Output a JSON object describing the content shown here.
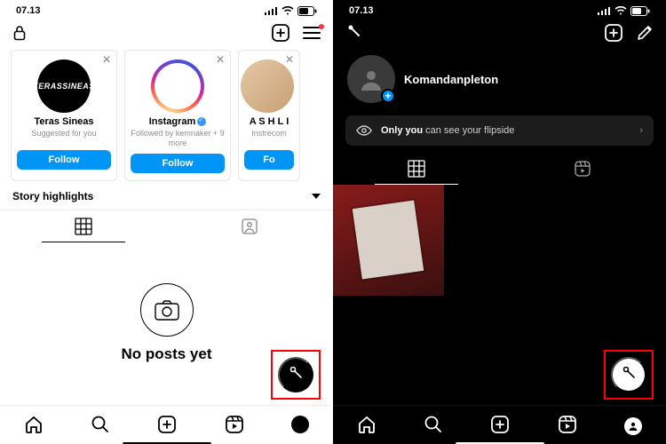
{
  "statusTime": "07.13",
  "light": {
    "suggestions": [
      {
        "name": "Teras Sineas",
        "sub": "Suggested for you",
        "follow": "Follow"
      },
      {
        "name": "Instagram",
        "sub": "Followed by kemnaker + 9 more",
        "follow": "Follow"
      },
      {
        "name": "A S H L I",
        "sub": "Instrecom",
        "follow": "Fo"
      }
    ],
    "storyHighlights": "Story highlights",
    "noPosts": "No posts yet"
  },
  "dark": {
    "username": "Komandanpleton",
    "flipsideLead": "Only you",
    "flipsideRest": " can see your flipside"
  }
}
